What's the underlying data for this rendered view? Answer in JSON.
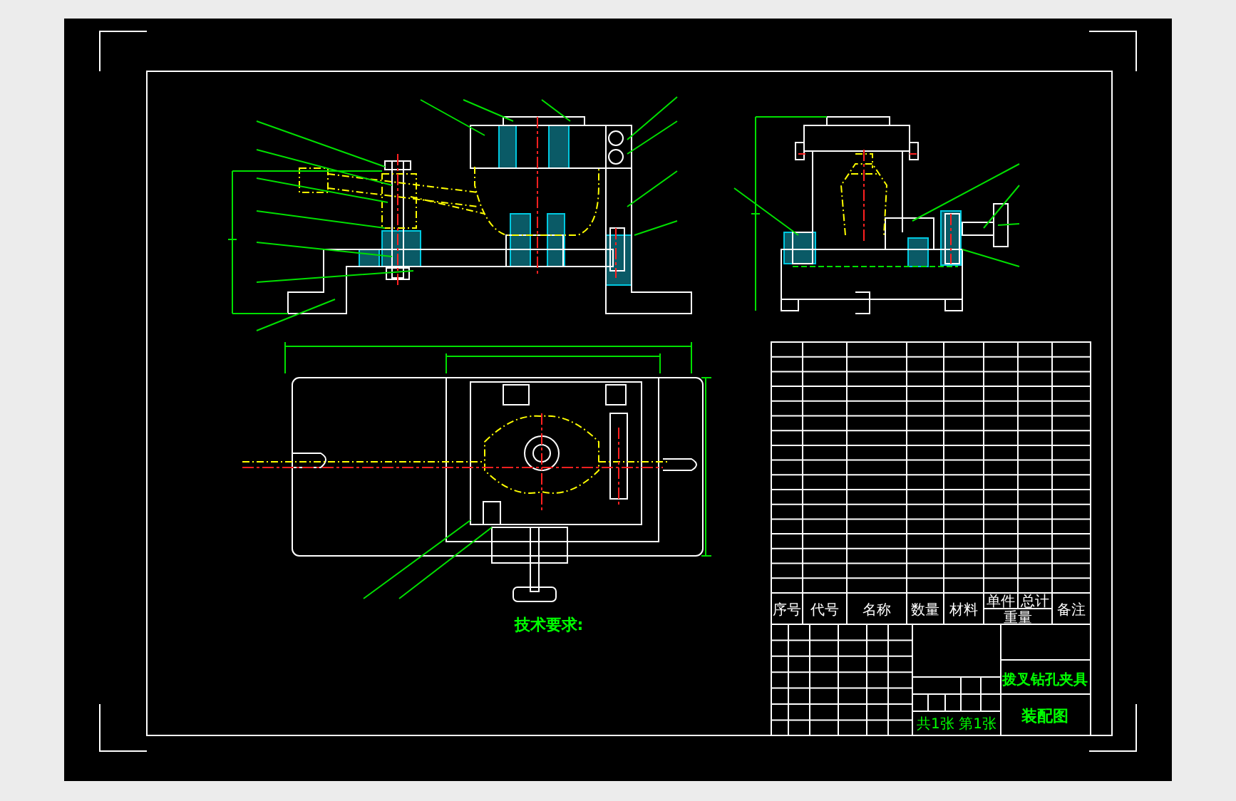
{
  "drawing": {
    "technical_requirements": {
      "heading": "技术要求:"
    },
    "parts_list": {
      "columns": [
        "序号",
        "代号",
        "名称",
        "数量",
        "材料",
        "单件",
        "总计",
        "重量",
        "备注"
      ]
    },
    "title_block": {
      "title": "拨叉钻孔夹具",
      "drawing_type": "装配图",
      "sheet": "共1张 第1张"
    }
  }
}
